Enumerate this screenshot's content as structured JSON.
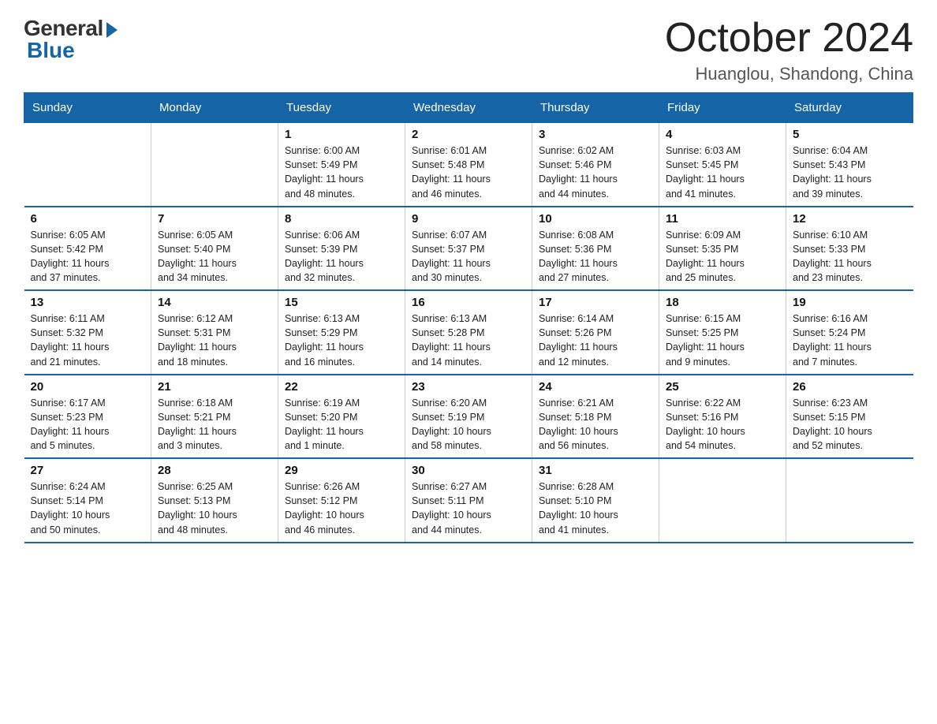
{
  "logo": {
    "general": "General",
    "blue": "Blue"
  },
  "title": "October 2024",
  "subtitle": "Huanglou, Shandong, China",
  "days_of_week": [
    "Sunday",
    "Monday",
    "Tuesday",
    "Wednesday",
    "Thursday",
    "Friday",
    "Saturday"
  ],
  "weeks": [
    [
      {
        "day": "",
        "info": ""
      },
      {
        "day": "",
        "info": ""
      },
      {
        "day": "1",
        "info": "Sunrise: 6:00 AM\nSunset: 5:49 PM\nDaylight: 11 hours\nand 48 minutes."
      },
      {
        "day": "2",
        "info": "Sunrise: 6:01 AM\nSunset: 5:48 PM\nDaylight: 11 hours\nand 46 minutes."
      },
      {
        "day": "3",
        "info": "Sunrise: 6:02 AM\nSunset: 5:46 PM\nDaylight: 11 hours\nand 44 minutes."
      },
      {
        "day": "4",
        "info": "Sunrise: 6:03 AM\nSunset: 5:45 PM\nDaylight: 11 hours\nand 41 minutes."
      },
      {
        "day": "5",
        "info": "Sunrise: 6:04 AM\nSunset: 5:43 PM\nDaylight: 11 hours\nand 39 minutes."
      }
    ],
    [
      {
        "day": "6",
        "info": "Sunrise: 6:05 AM\nSunset: 5:42 PM\nDaylight: 11 hours\nand 37 minutes."
      },
      {
        "day": "7",
        "info": "Sunrise: 6:05 AM\nSunset: 5:40 PM\nDaylight: 11 hours\nand 34 minutes."
      },
      {
        "day": "8",
        "info": "Sunrise: 6:06 AM\nSunset: 5:39 PM\nDaylight: 11 hours\nand 32 minutes."
      },
      {
        "day": "9",
        "info": "Sunrise: 6:07 AM\nSunset: 5:37 PM\nDaylight: 11 hours\nand 30 minutes."
      },
      {
        "day": "10",
        "info": "Sunrise: 6:08 AM\nSunset: 5:36 PM\nDaylight: 11 hours\nand 27 minutes."
      },
      {
        "day": "11",
        "info": "Sunrise: 6:09 AM\nSunset: 5:35 PM\nDaylight: 11 hours\nand 25 minutes."
      },
      {
        "day": "12",
        "info": "Sunrise: 6:10 AM\nSunset: 5:33 PM\nDaylight: 11 hours\nand 23 minutes."
      }
    ],
    [
      {
        "day": "13",
        "info": "Sunrise: 6:11 AM\nSunset: 5:32 PM\nDaylight: 11 hours\nand 21 minutes."
      },
      {
        "day": "14",
        "info": "Sunrise: 6:12 AM\nSunset: 5:31 PM\nDaylight: 11 hours\nand 18 minutes."
      },
      {
        "day": "15",
        "info": "Sunrise: 6:13 AM\nSunset: 5:29 PM\nDaylight: 11 hours\nand 16 minutes."
      },
      {
        "day": "16",
        "info": "Sunrise: 6:13 AM\nSunset: 5:28 PM\nDaylight: 11 hours\nand 14 minutes."
      },
      {
        "day": "17",
        "info": "Sunrise: 6:14 AM\nSunset: 5:26 PM\nDaylight: 11 hours\nand 12 minutes."
      },
      {
        "day": "18",
        "info": "Sunrise: 6:15 AM\nSunset: 5:25 PM\nDaylight: 11 hours\nand 9 minutes."
      },
      {
        "day": "19",
        "info": "Sunrise: 6:16 AM\nSunset: 5:24 PM\nDaylight: 11 hours\nand 7 minutes."
      }
    ],
    [
      {
        "day": "20",
        "info": "Sunrise: 6:17 AM\nSunset: 5:23 PM\nDaylight: 11 hours\nand 5 minutes."
      },
      {
        "day": "21",
        "info": "Sunrise: 6:18 AM\nSunset: 5:21 PM\nDaylight: 11 hours\nand 3 minutes."
      },
      {
        "day": "22",
        "info": "Sunrise: 6:19 AM\nSunset: 5:20 PM\nDaylight: 11 hours\nand 1 minute."
      },
      {
        "day": "23",
        "info": "Sunrise: 6:20 AM\nSunset: 5:19 PM\nDaylight: 10 hours\nand 58 minutes."
      },
      {
        "day": "24",
        "info": "Sunrise: 6:21 AM\nSunset: 5:18 PM\nDaylight: 10 hours\nand 56 minutes."
      },
      {
        "day": "25",
        "info": "Sunrise: 6:22 AM\nSunset: 5:16 PM\nDaylight: 10 hours\nand 54 minutes."
      },
      {
        "day": "26",
        "info": "Sunrise: 6:23 AM\nSunset: 5:15 PM\nDaylight: 10 hours\nand 52 minutes."
      }
    ],
    [
      {
        "day": "27",
        "info": "Sunrise: 6:24 AM\nSunset: 5:14 PM\nDaylight: 10 hours\nand 50 minutes."
      },
      {
        "day": "28",
        "info": "Sunrise: 6:25 AM\nSunset: 5:13 PM\nDaylight: 10 hours\nand 48 minutes."
      },
      {
        "day": "29",
        "info": "Sunrise: 6:26 AM\nSunset: 5:12 PM\nDaylight: 10 hours\nand 46 minutes."
      },
      {
        "day": "30",
        "info": "Sunrise: 6:27 AM\nSunset: 5:11 PM\nDaylight: 10 hours\nand 44 minutes."
      },
      {
        "day": "31",
        "info": "Sunrise: 6:28 AM\nSunset: 5:10 PM\nDaylight: 10 hours\nand 41 minutes."
      },
      {
        "day": "",
        "info": ""
      },
      {
        "day": "",
        "info": ""
      }
    ]
  ]
}
